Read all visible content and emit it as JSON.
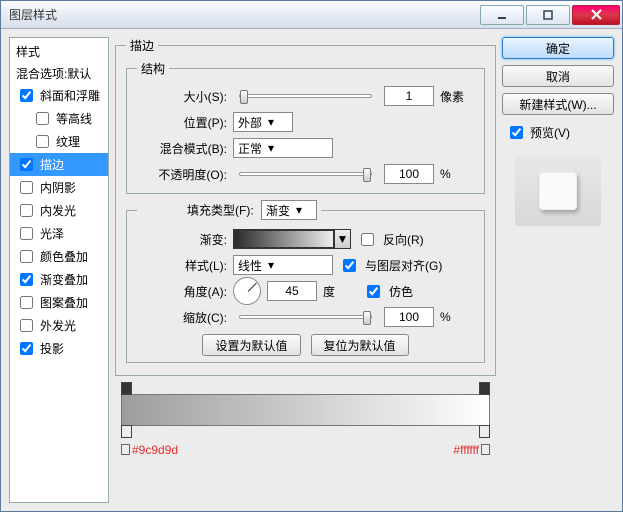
{
  "window": {
    "title": "图层样式"
  },
  "sidebar": {
    "header": "样式",
    "items": [
      {
        "label": "混合选项:默认",
        "checked": null
      },
      {
        "label": "斜面和浮雕",
        "checked": true
      },
      {
        "label": "等高线",
        "checked": false,
        "indent": true
      },
      {
        "label": "纹理",
        "checked": false,
        "indent": true
      },
      {
        "label": "描边",
        "checked": true,
        "selected": true
      },
      {
        "label": "内阴影",
        "checked": false
      },
      {
        "label": "内发光",
        "checked": false
      },
      {
        "label": "光泽",
        "checked": false
      },
      {
        "label": "颜色叠加",
        "checked": false
      },
      {
        "label": "渐变叠加",
        "checked": true
      },
      {
        "label": "图案叠加",
        "checked": false
      },
      {
        "label": "外发光",
        "checked": false
      },
      {
        "label": "投影",
        "checked": true
      }
    ]
  },
  "panel": {
    "title": "描边",
    "group1": {
      "legend": "结构",
      "size_label": "大小(S):",
      "size_value": "1",
      "size_unit": "像素",
      "position_label": "位置(P):",
      "position_value": "外部",
      "blend_label": "混合模式(B):",
      "blend_value": "正常",
      "opacity_label": "不透明度(O):",
      "opacity_value": "100",
      "opacity_unit": "%"
    },
    "group2": {
      "filltype_label": "填充类型(F):",
      "filltype_value": "渐变",
      "gradient_label": "渐变:",
      "reverse_label": "反向(R)",
      "style_label": "样式(L):",
      "style_value": "线性",
      "align_label": "与图层对齐(G)",
      "angle_label": "角度(A):",
      "angle_value": "45",
      "angle_unit": "度",
      "dither_label": "仿色",
      "scale_label": "缩放(C):",
      "scale_value": "100",
      "scale_unit": "%",
      "btn_setdef": "设置为默认值",
      "btn_resetdef": "复位为默认值"
    },
    "gradient_stops": {
      "left_color": "#9c9d9d",
      "right_color": "#ffffff"
    }
  },
  "actions": {
    "ok": "确定",
    "cancel": "取消",
    "newstyle": "新建样式(W)...",
    "preview": "预览(V)"
  }
}
